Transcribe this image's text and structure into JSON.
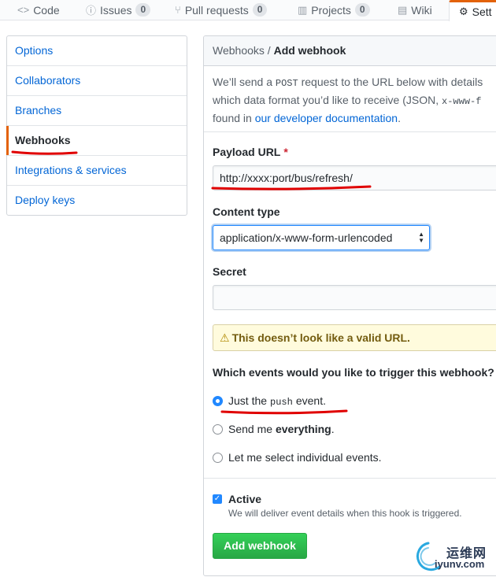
{
  "tabs": [
    {
      "label": "Code",
      "icon": "code-icon",
      "glyph": "<>"
    },
    {
      "label": "Issues",
      "icon": "issue-icon",
      "glyph": "ⓘ",
      "count": "0"
    },
    {
      "label": "Pull requests",
      "icon": "pull-request-icon",
      "glyph": "⑂",
      "count": "0"
    },
    {
      "label": "Projects",
      "icon": "project-icon",
      "glyph": "▥",
      "count": "0"
    },
    {
      "label": "Wiki",
      "icon": "book-icon",
      "glyph": "▤"
    },
    {
      "label": "Sett",
      "icon": "gear-icon",
      "glyph": "⚙"
    }
  ],
  "sidebar": {
    "items": [
      {
        "label": "Options"
      },
      {
        "label": "Collaborators"
      },
      {
        "label": "Branches"
      },
      {
        "label": "Webhooks",
        "selected": true
      },
      {
        "label": "Integrations & services"
      },
      {
        "label": "Deploy keys"
      }
    ]
  },
  "panel": {
    "breadcrumb_parent": "Webhooks",
    "breadcrumb_sep": " / ",
    "breadcrumb_current": "Add webhook",
    "intro": {
      "line1_a": "We’ll send a ",
      "line1_code": "POST",
      "line1_b": " request to the URL below with details",
      "line2_a": "which data format you’d like to receive (JSON, ",
      "line2_code": "x-www-f",
      "line3_a": "found in ",
      "line3_link": "our developer documentation",
      "line3_b": "."
    },
    "payload_label": "Payload URL",
    "required_mark": "*",
    "payload_value": "http://xxxx:port/bus/refresh/",
    "content_type_label": "Content type",
    "content_type_value": "application/x-www-form-urlencoded",
    "secret_label": "Secret",
    "secret_value": "",
    "warning_text": "This doesn’t look like a valid URL.",
    "events_question": "Which events would you like to trigger this webhook?",
    "events": {
      "just_push_a": "Just the",
      "just_push_code": "push",
      "just_push_b": "event.",
      "everything_a": "Send me ",
      "everything_b": "everything",
      "everything_c": ".",
      "individual": "Let me select individual events."
    },
    "selected_event": "just_push",
    "active_label": "Active",
    "active_checked": true,
    "active_note": "We will deliver event details when this hook is triggered.",
    "submit_label": "Add webhook"
  },
  "watermark": {
    "cn": "运维网",
    "en": "iyunv.com"
  },
  "colors": {
    "link": "#0366d6",
    "selected_accent": "#e36209",
    "primary_button": "#28a745",
    "annotation": "#e00000",
    "warning_bg": "#fffbdd"
  }
}
